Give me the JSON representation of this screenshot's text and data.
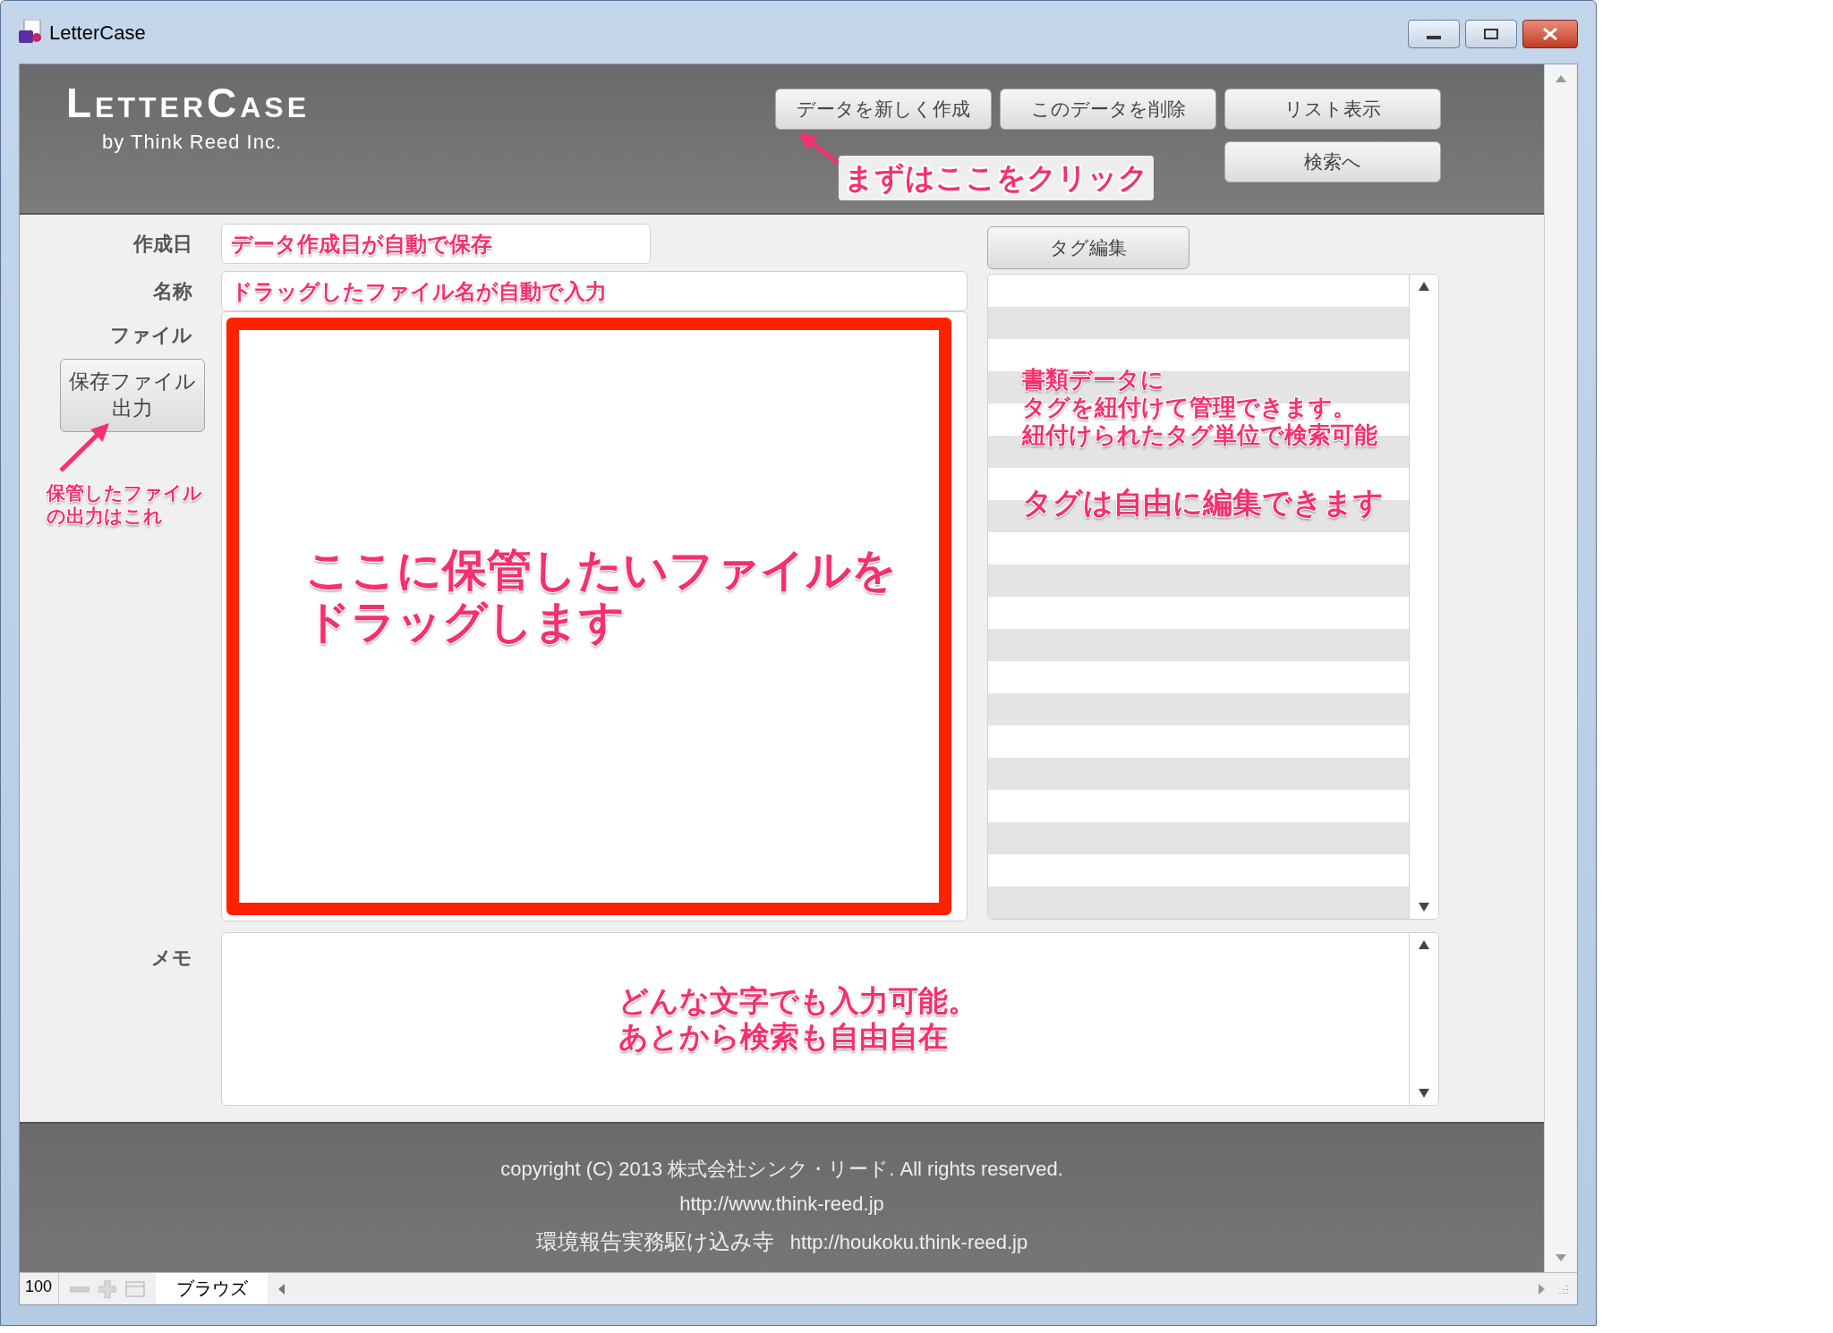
{
  "window": {
    "title": "LetterCase"
  },
  "header": {
    "logo": {
      "title": "LetterCase",
      "subtitle": "by Think Reed Inc."
    },
    "buttons": [
      {
        "label": "データを新しく作成"
      },
      {
        "label": "このデータを削除"
      },
      {
        "label": "リスト表示"
      },
      {
        "label": "検索へ"
      }
    ],
    "callout": "まずはここをクリック"
  },
  "form": {
    "fields": [
      {
        "label": "作成日",
        "value": "データ作成日が自動で保存"
      },
      {
        "label": "名称",
        "value": "ドラッグしたファイル名が自動で入力"
      }
    ],
    "file": {
      "label": "ファイル",
      "export_button": [
        "保存ファイル",
        "出力"
      ],
      "callout": "保管したファイルの出力はこれ",
      "drop_text": [
        "ここに保管したいファイルを",
        "ドラッグします"
      ]
    },
    "tags": {
      "button": "タグ編集",
      "callout": [
        "書類データに",
        "タグを紐付けて管理できます。",
        "紐付けられたタグ単位で検索可能"
      ],
      "callout_2": "タグは自由に編集できます"
    },
    "memo": {
      "label": "メモ",
      "callout": [
        "どんな文字でも入力可能。",
        "あとから検索も自由自在"
      ]
    }
  },
  "footer": {
    "copyright": "copyright (C) 2013 株式会社シンク・リード. All rights reserved.",
    "url": "http://www.think-reed.jp",
    "partner_name": "環境報告実務駆け込み寺",
    "partner_url": "http://houkoku.think-reed.jp"
  },
  "status_bar": {
    "zoom": "100",
    "mode": "ブラウズ"
  }
}
